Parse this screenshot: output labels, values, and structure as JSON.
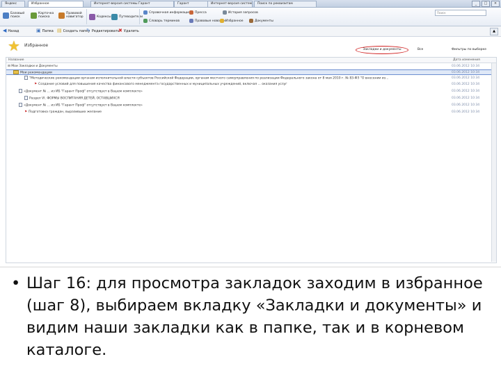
{
  "window": {
    "tabs": [
      "Яндекс",
      "Избранное",
      "Интернет-версия системы Гарант",
      "Гарант",
      "Интернет-версия системы",
      "Поиск по реквизитам"
    ],
    "search_placeholder": "Поиск"
  },
  "ribbon": {
    "groups": [
      {
        "label": "Базовый поиск",
        "color": "#4c7fc4"
      },
      {
        "label": "Карточка поиска",
        "color": "#6a9a3a"
      },
      {
        "label": "Правовой навигатор",
        "color": "#c77a2a"
      },
      {
        "label": "Кодексы",
        "color": "#8a5aa8"
      },
      {
        "label": "Путеводители",
        "color": "#3a8aa8"
      }
    ],
    "links": [
      {
        "label": "Справочная информация",
        "color": "#5a86c8"
      },
      {
        "label": "Словарь терминов",
        "color": "#4f9a5a"
      },
      {
        "label": "Пресса",
        "color": "#c8663a"
      },
      {
        "label": "Правовые новости",
        "color": "#6a7ab8"
      },
      {
        "label": "Избранное",
        "color": "#e0b030"
      },
      {
        "label": "История запросов",
        "color": "#7a8a9a"
      },
      {
        "label": "Документы",
        "color": "#9a6a3a"
      }
    ]
  },
  "toolbar": {
    "items": [
      "Назад",
      "Папка",
      "Создать папку",
      "Редактировать",
      "Удалить"
    ]
  },
  "pane": {
    "title": "Избранное",
    "tabs": [
      "Закладки и документы",
      "Все",
      "Фильтры по выборке"
    ]
  },
  "tree": {
    "col_name": "Название",
    "col_date": "Дата изменения",
    "rows": [
      {
        "indent": 2,
        "kind": "toggle",
        "text": "Мои Закладки и Документы",
        "date": "03.06.2012 10:34"
      },
      {
        "indent": 10,
        "kind": "folder",
        "text": "Мои рекомендации",
        "date": "03.06.2012 10:34",
        "highlight": true
      },
      {
        "indent": 26,
        "kind": "doc",
        "text": "\"Методические рекомендации органам исполнительной власти субъектов Российской Федерации, органам местного самоуправления по реализации Федерального закона от 8 мая 2010 г. № 83-ФЗ \"О внесении из...",
        "date": "03.06.2012 10:34"
      },
      {
        "indent": 40,
        "kind": "bookmark",
        "text": "Создание условий для повышения качества финансового менеджмента государственных и муниципальных учреждений, включая ... оказания услуг",
        "date": "03.06.2012 10:34"
      },
      {
        "indent": 18,
        "kind": "doc",
        "text": "«Документ № ... из ИБ \"Гарант Проф\" отсутствует в Вашем комплекте»",
        "date": "03.06.2012 10:34"
      },
      {
        "indent": 26,
        "kind": "doc",
        "text": "Раздел VI. ФОРМЫ ВОСПИТАНИЯ ДЕТЕЙ, ОСТАВШИХСЯ",
        "date": "03.06.2012 10:34"
      },
      {
        "indent": 18,
        "kind": "doc",
        "text": "«Документ № ... из ИБ \"Гарант Проф\" отсутствует в Вашем комплекте»",
        "date": "03.06.2012 10:34"
      },
      {
        "indent": 26,
        "kind": "bookmark",
        "text": "Подготовка граждан, выразивших желание",
        "date": "03.06.2012 10:34"
      }
    ]
  },
  "caption": {
    "bullet": "•",
    "text": "Шаг 16: для просмотра закладок заходим в избранное (шаг 8), выбираем вкладку «Закладки и документы» и видим наши закладки как в папке, так и в корневом каталоге."
  }
}
